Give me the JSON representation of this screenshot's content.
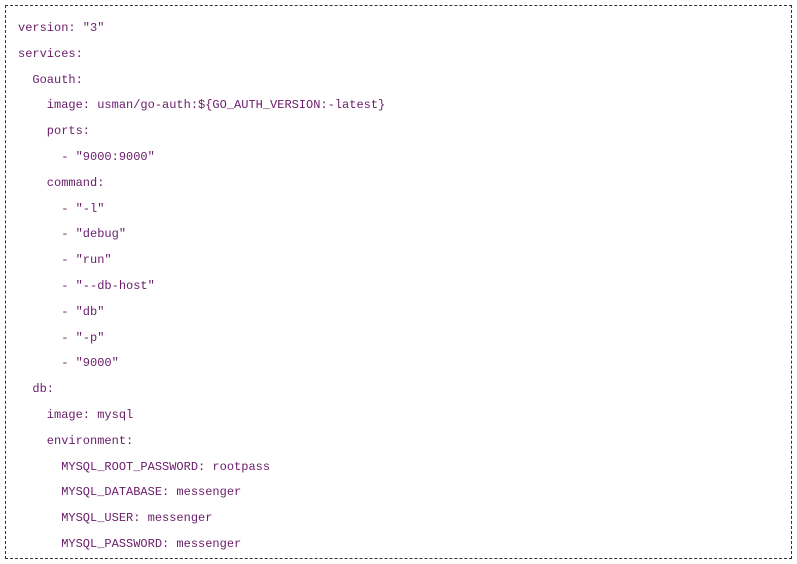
{
  "code": {
    "lines": [
      "version: \"3\"",
      "services:",
      "  Goauth:",
      "    image: usman/go-auth:${GO_AUTH_VERSION:-latest}",
      "    ports:",
      "      - \"9000:9000\"",
      "    command:",
      "      - \"-l\"",
      "      - \"debug\"",
      "      - \"run\"",
      "      - \"--db-host\"",
      "      - \"db\"",
      "      - \"-p\"",
      "      - \"9000\"",
      "  db:",
      "    image: mysql",
      "    environment:",
      "      MYSQL_ROOT_PASSWORD: rootpass",
      "      MYSQL_DATABASE: messenger",
      "      MYSQL_USER: messenger",
      "      MYSQL_PASSWORD: messenger"
    ]
  }
}
